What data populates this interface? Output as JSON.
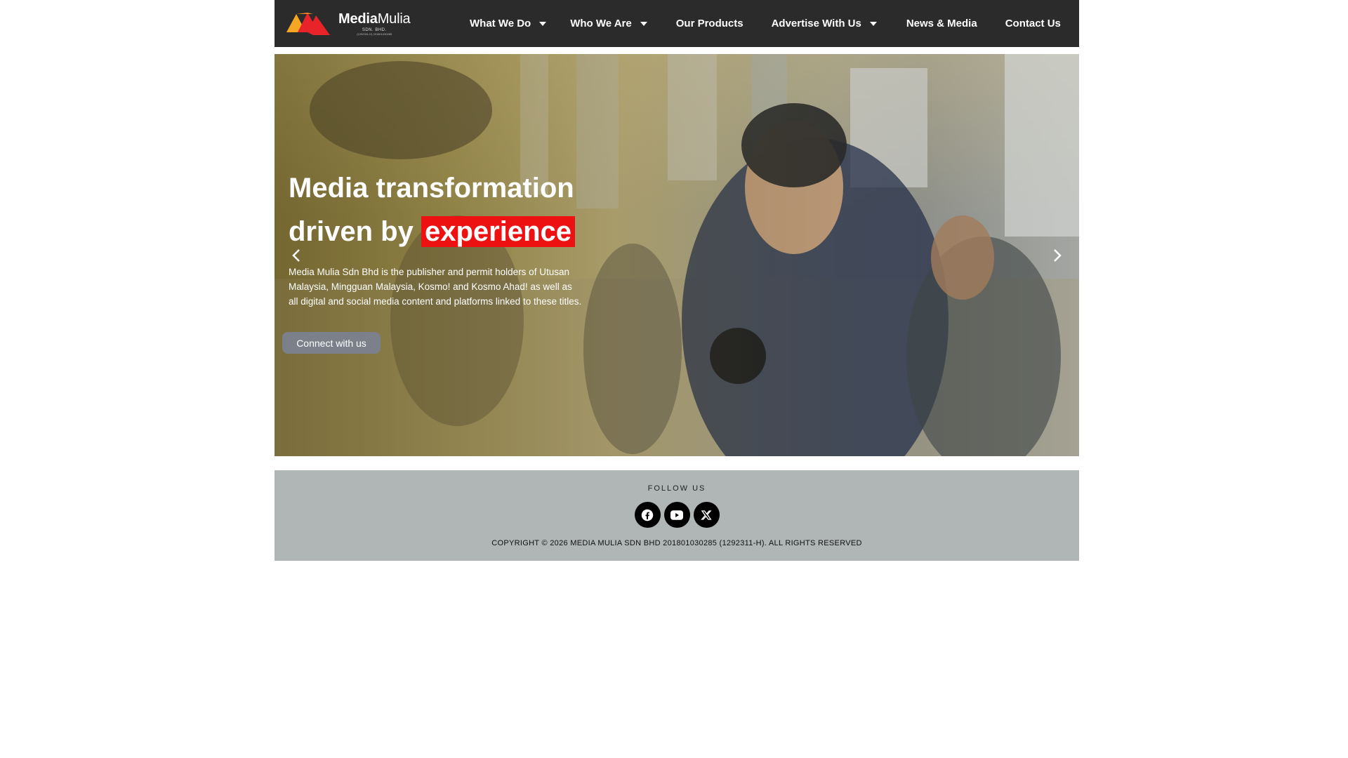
{
  "brand": {
    "name_bold": "Media",
    "name_regular": "Mulia",
    "sub": "SDN. BHD.",
    "sub2": "(1292311-H) 201801030285",
    "colors": {
      "orange": "#f5a623",
      "red": "#e8232a"
    }
  },
  "nav": {
    "items": [
      {
        "label": "What We Do",
        "has_dropdown": true
      },
      {
        "label": "Who We Are",
        "has_dropdown": true
      },
      {
        "label": "Our Products",
        "has_dropdown": false
      },
      {
        "label": "Advertise With Us",
        "has_dropdown": true
      },
      {
        "label": "News & Media",
        "has_dropdown": false
      },
      {
        "label": "Contact Us",
        "has_dropdown": false
      }
    ]
  },
  "hero": {
    "title_line1": "Media transformation",
    "title_line2_prefix": "driven by",
    "title_highlight": "experience",
    "highlight_color": "#ee1111",
    "description": "Media Mulia Sdn Bhd is the publisher and permit holders of Utusan Malaysia, Mingguan Malaysia, Kosmo! and Kosmo Ahad! as well as all digital and social media content and platforms linked to these titles.",
    "cta_label": "Connect with us",
    "prev_icon": "chevron-left-icon",
    "next_icon": "chevron-right-icon"
  },
  "footer": {
    "follow_label": "FOLLOW US",
    "socials": [
      {
        "name": "facebook-icon"
      },
      {
        "name": "youtube-icon"
      },
      {
        "name": "x-icon"
      }
    ],
    "copyright": "COPYRIGHT © 2026 MEDIA MULIA SDN BHD 201801030285 (1292311-H). ALL RIGHTS RESERVED"
  }
}
